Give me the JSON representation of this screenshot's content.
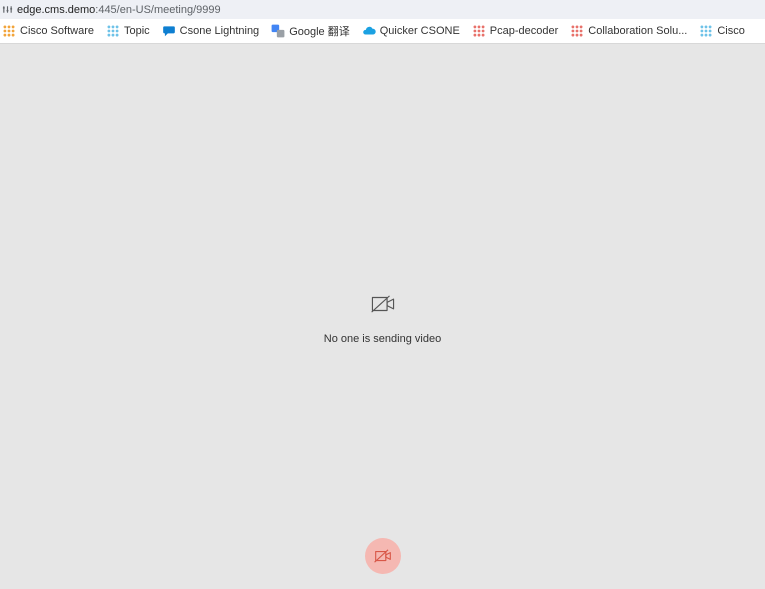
{
  "address": {
    "host": "edge.cms.demo",
    "port_path": ":445/en-US/meeting/9999"
  },
  "bookmarks": [
    {
      "label": "Cisco Software",
      "icon": "grid",
      "color": "#f2a43a"
    },
    {
      "label": "Topic",
      "icon": "grid",
      "color": "#6ec2e8"
    },
    {
      "label": "Csone Lightning",
      "icon": "chat",
      "color": "#0e7fd1"
    },
    {
      "label": "Google 翻译",
      "icon": "translate",
      "color": "#4285f4"
    },
    {
      "label": "Quicker CSONE",
      "icon": "cloud",
      "color": "#1ba1e2"
    },
    {
      "label": "Pcap-decoder",
      "icon": "grid",
      "color": "#e8716a"
    },
    {
      "label": "Collaboration Solu...",
      "icon": "grid",
      "color": "#e8716a"
    },
    {
      "label": "Cisco",
      "icon": "grid",
      "color": "#6ec2e8"
    }
  ],
  "main": {
    "no_video_label": "No one is sending video"
  },
  "colors": {
    "page_bg": "#e6e6e6",
    "cam_btn": "#f5b8b2",
    "cam_icon": "#d85748"
  }
}
